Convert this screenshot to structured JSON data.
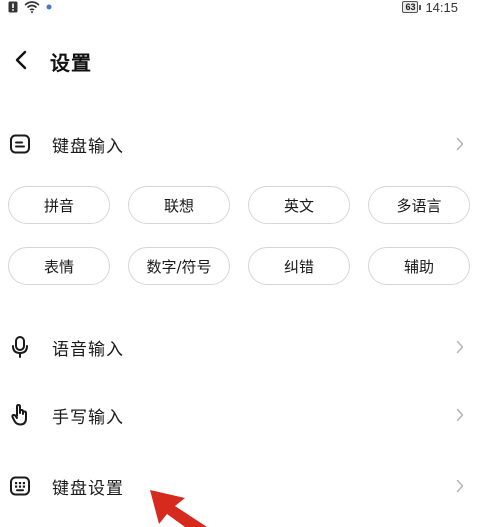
{
  "status_bar": {
    "battery": "63",
    "time": "14:15"
  },
  "header": {
    "title": "设置"
  },
  "keyboard_input": {
    "label": "键盘输入",
    "options": [
      "拼音",
      "联想",
      "英文",
      "多语言",
      "表情",
      "数字/符号",
      "纠错",
      "辅助"
    ]
  },
  "voice_input": {
    "label": "语音输入"
  },
  "handwriting_input": {
    "label": "手写输入"
  },
  "keyboard_settings": {
    "label": "键盘设置"
  },
  "colors": {
    "text": "#1a1a1a",
    "chevron": "#b5b5b5",
    "chip_border": "#d6d6d6",
    "annotation_arrow": "#d62a1e"
  }
}
